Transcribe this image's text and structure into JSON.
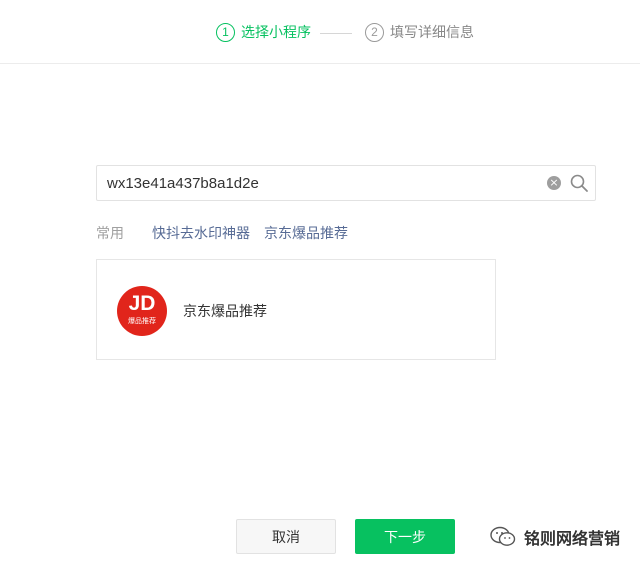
{
  "stepper": {
    "steps": [
      {
        "num": "1",
        "label": "选择小程序",
        "active": true
      },
      {
        "num": "2",
        "label": "填写详细信息",
        "active": false
      }
    ]
  },
  "search": {
    "value": "wx13e41a437b8a1d2e",
    "clear_icon": "clear-circle-icon",
    "search_icon": "magnifier-icon"
  },
  "common": {
    "label": "常用",
    "links": [
      "快抖去水印神器",
      "京东爆品推荐"
    ]
  },
  "result": {
    "logo_main": "JD",
    "logo_sub": "爆品推荐",
    "name": "京东爆品推荐",
    "logo_color": "#e1251b"
  },
  "buttons": {
    "cancel": "取消",
    "next": "下一步"
  },
  "watermark": {
    "text": "铭则网络营销",
    "icon": "wechat-official-account-icon"
  },
  "colors": {
    "accent": "#07c160",
    "link": "#576b95",
    "inactive": "#888888"
  }
}
